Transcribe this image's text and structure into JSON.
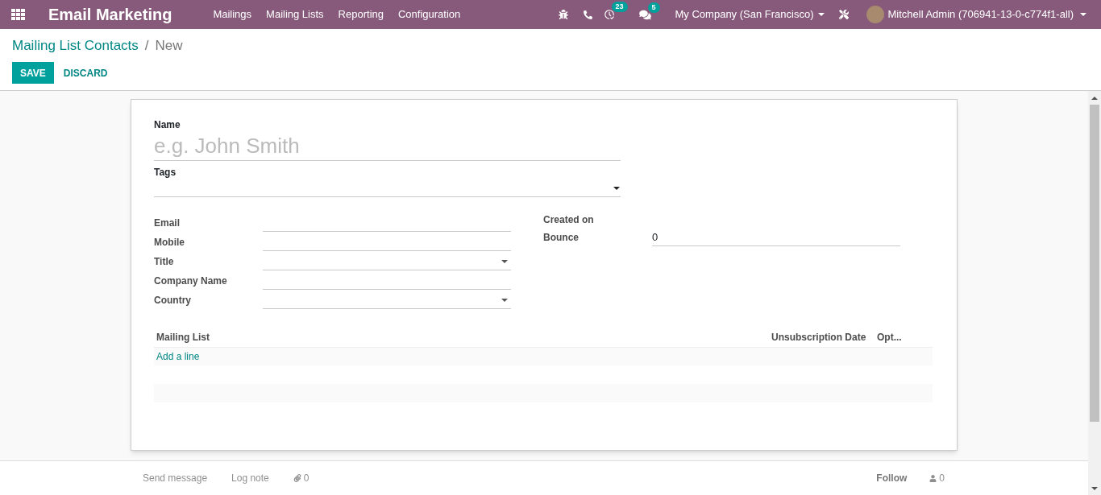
{
  "navbar": {
    "app_title": "Email Marketing",
    "menu": [
      {
        "label": "Mailings"
      },
      {
        "label": "Mailing Lists"
      },
      {
        "label": "Reporting"
      },
      {
        "label": "Configuration"
      }
    ],
    "activity_count": "23",
    "message_count": "5",
    "company": "My Company (San Francisco)",
    "user": "Mitchell Admin (706941-13-0-c774f1-all)"
  },
  "breadcrumb": {
    "parent": "Mailing List Contacts",
    "separator": "/",
    "current": "New"
  },
  "buttons": {
    "save": "SAVE",
    "discard": "DISCARD"
  },
  "form": {
    "name": {
      "label": "Name",
      "placeholder": "e.g. John Smith"
    },
    "tags": {
      "label": "Tags"
    },
    "left_fields": [
      {
        "label": "Email",
        "kind": "input"
      },
      {
        "label": "Mobile",
        "kind": "input"
      },
      {
        "label": "Title",
        "kind": "select"
      },
      {
        "label": "Company Name",
        "kind": "input"
      },
      {
        "label": "Country",
        "kind": "select"
      }
    ],
    "right_fields": [
      {
        "label": "Created on",
        "kind": "readonly"
      },
      {
        "label": "Bounce",
        "kind": "input",
        "value": "0"
      }
    ],
    "table": {
      "columns": [
        "Mailing List",
        "Unsubscription Date",
        "Opt..."
      ],
      "add_line": "Add a line"
    }
  },
  "chatter": {
    "send_message": "Send message",
    "log_note": "Log note",
    "attachments": "0",
    "follow": "Follow",
    "followers": "0"
  }
}
